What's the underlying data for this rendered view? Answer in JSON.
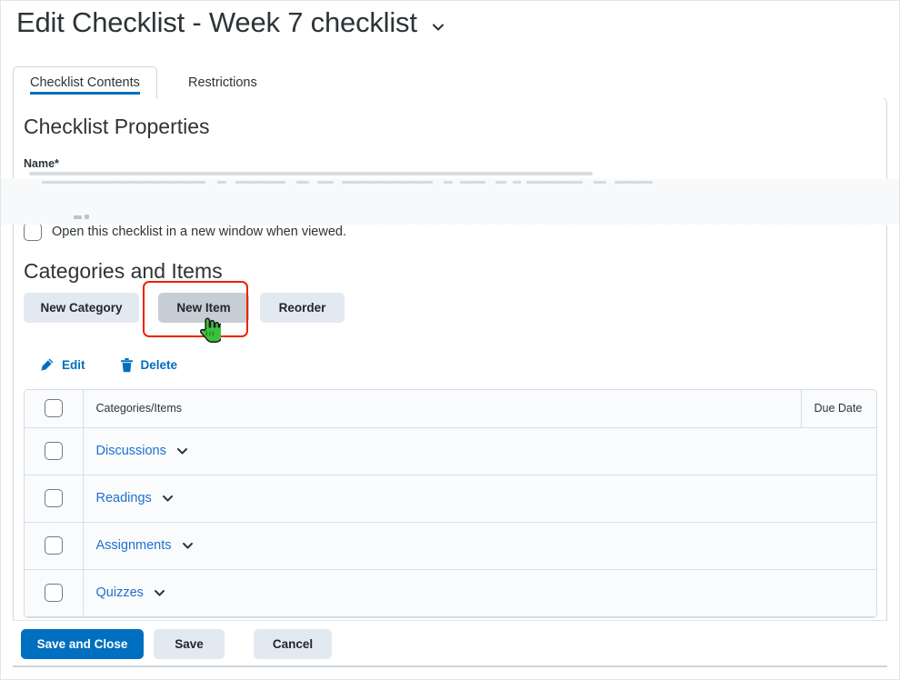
{
  "header": {
    "title": "Edit Checklist - Week 7 checklist",
    "title_chevron_icon": "chevron-down-icon"
  },
  "tabs": [
    {
      "label": "Checklist Contents",
      "active": true
    },
    {
      "label": "Restrictions",
      "active": false
    }
  ],
  "properties": {
    "heading": "Checklist Properties",
    "name_label": "Name",
    "name_required_marker": "*",
    "new_window_checkbox_label": "Open this checklist in a new window when viewed."
  },
  "categories_section": {
    "heading": "Categories and Items",
    "buttons": {
      "new_category": "New Category",
      "new_item": "New Item",
      "reorder": "Reorder"
    },
    "new_item_state": "pressed",
    "annotation_color": "#ee2200",
    "cursor_icon": "hand-pointer-cursor",
    "tools": [
      {
        "label": "Edit",
        "icon": "pencil-icon"
      },
      {
        "label": "Delete",
        "icon": "trash-icon"
      }
    ]
  },
  "table": {
    "columns": {
      "select_all": "",
      "name": "Categories/Items",
      "due_date": "Due Date"
    },
    "rows": [
      {
        "name": "Discussions",
        "due_date": "",
        "chevron_icon": "chevron-down-icon",
        "checked": false
      },
      {
        "name": "Readings",
        "due_date": "",
        "chevron_icon": "chevron-down-icon",
        "checked": false
      },
      {
        "name": "Assignments",
        "due_date": "",
        "chevron_icon": "chevron-down-icon",
        "checked": false
      },
      {
        "name": "Quizzes",
        "due_date": "",
        "chevron_icon": "chevron-down-icon",
        "checked": false
      }
    ]
  },
  "footer": {
    "save_and_close": "Save and Close",
    "save": "Save",
    "cancel": "Cancel"
  },
  "colors": {
    "primary_blue": "#006fbf",
    "link_blue": "#1f6fcc",
    "button_grey": "#e3e9f0",
    "button_pressed_grey": "#c7cdd4",
    "annotation_red": "#ee2200",
    "cursor_green": "#3dc13d",
    "table_row_bg": "#f9fbfd",
    "border_grey": "#d6dde4"
  }
}
